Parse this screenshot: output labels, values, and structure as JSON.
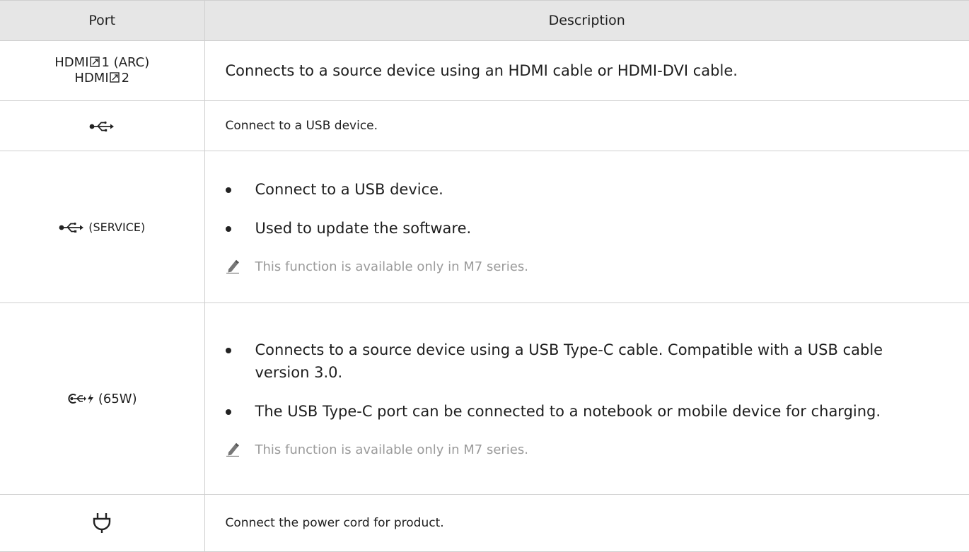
{
  "header": {
    "port": "Port",
    "description": "Description"
  },
  "rows": [
    {
      "port_lines": [
        "HDMI",
        "1 (ARC)",
        "HDMI",
        "2"
      ],
      "description": "Connects to a source device using an HDMI cable or HDMI-DVI cable."
    },
    {
      "port_icon": "usb-icon",
      "description": "Connect to a USB device."
    },
    {
      "port_icon": "usb-icon",
      "port_suffix": "(SERVICE)",
      "bullets": [
        "Connect to a USB device.",
        "Used to update the software."
      ],
      "note": "This function is available only in M7 series."
    },
    {
      "port_icon": "usb-type-c-charging-icon",
      "port_suffix": "(65W)",
      "bullets": [
        "Connects to a source device using a USB Type-C cable. Compatible with a USB cable version 3.0.",
        "The USB Type-C port can be connected to a notebook or mobile device for charging."
      ],
      "note": "This function is available only in M7 series."
    },
    {
      "port_icon": "power-plug-icon",
      "description": "Connect the power cord for product."
    }
  ],
  "colors": {
    "header_bg": "#e6e6e6",
    "border": "#cfcfcf",
    "note_text": "#9a9a9a"
  }
}
